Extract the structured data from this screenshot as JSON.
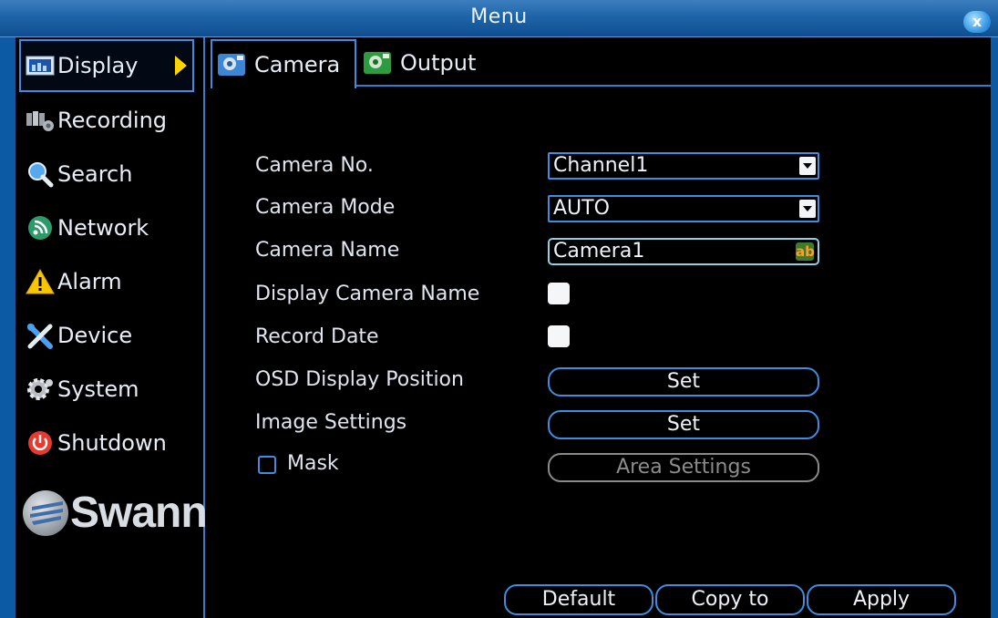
{
  "window": {
    "title": "Menu",
    "close_label": "x"
  },
  "sidebar": {
    "items": [
      {
        "label": "Display",
        "icon": "display-icon",
        "active": true
      },
      {
        "label": "Recording",
        "icon": "recording-icon"
      },
      {
        "label": "Search",
        "icon": "search-icon"
      },
      {
        "label": "Network",
        "icon": "network-icon"
      },
      {
        "label": "Alarm",
        "icon": "alarm-icon"
      },
      {
        "label": "Device",
        "icon": "device-icon"
      },
      {
        "label": "System",
        "icon": "system-icon"
      },
      {
        "label": "Shutdown",
        "icon": "shutdown-icon"
      }
    ],
    "logo": "Swann."
  },
  "tabs": [
    {
      "label": "Camera",
      "icon": "camera-tab-icon",
      "active": true
    },
    {
      "label": "Output",
      "icon": "output-tab-icon"
    }
  ],
  "form": {
    "camera_no": {
      "label": "Camera No.",
      "value": "Channel1"
    },
    "camera_mode": {
      "label": "Camera Mode",
      "value": "AUTO"
    },
    "camera_name": {
      "label": "Camera Name",
      "value": "Camera1",
      "edit_icon": "ab"
    },
    "display_camera_name": {
      "label": "Display Camera Name",
      "checked": false
    },
    "record_date": {
      "label": "Record Date",
      "checked": false
    },
    "osd_position": {
      "label": "OSD Display Position",
      "button": "Set"
    },
    "image_settings": {
      "label": "Image Settings",
      "button": "Set"
    },
    "mask": {
      "label": "Mask",
      "checked": false,
      "button": "Area Settings"
    }
  },
  "footer": {
    "default": "Default",
    "copy_to": "Copy to",
    "apply": "Apply"
  },
  "colors": {
    "accent": "#3c8fe0",
    "titlebar": "#1f64a8",
    "background": "#000000",
    "active_arrow": "#ffd500"
  }
}
